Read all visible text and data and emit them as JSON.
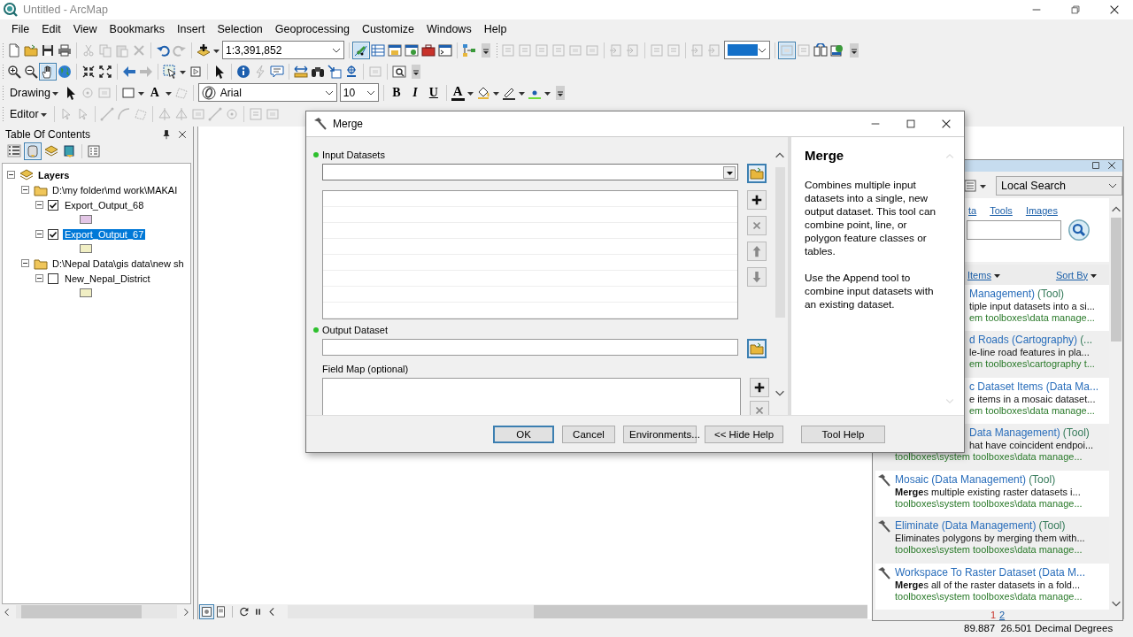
{
  "window": {
    "title": "Untitled - ArcMap"
  },
  "menu": [
    "File",
    "Edit",
    "View",
    "Bookmarks",
    "Insert",
    "Selection",
    "Geoprocessing",
    "Customize",
    "Windows",
    "Help"
  ],
  "toolbars": {
    "scale": "1:3,391,852",
    "drawing_menu": "Drawing",
    "text_tool": "A",
    "font": "Arial",
    "font_size": "10",
    "format_buttons": [
      "B",
      "I",
      "U"
    ],
    "font_color": "A",
    "editor_menu": "Editor"
  },
  "table_of_contents": {
    "title": "Table Of Contents",
    "tree": [
      {
        "kind": "frame",
        "label": "Layers",
        "expanded": true,
        "children": [
          {
            "kind": "group",
            "label": "D:\\my folder\\md work\\MAKAI",
            "expanded": true,
            "children": [
              {
                "kind": "layer",
                "label": "Export_Output_68",
                "expanded": true,
                "checked": true,
                "selected": false,
                "color": "#e3c6e6"
              },
              {
                "kind": "layer",
                "label": "Export_Output_67",
                "expanded": true,
                "checked": true,
                "selected": true,
                "color": "#f1efc4"
              }
            ]
          },
          {
            "kind": "group",
            "label": "D:\\Nepal Data\\gis data\\new sh",
            "expanded": true,
            "children": [
              {
                "kind": "layer",
                "label": "New_Nepal_District",
                "expanded": true,
                "checked": false,
                "selected": false,
                "color": "#f1efc4"
              }
            ]
          }
        ]
      }
    ]
  },
  "merge_dialog": {
    "title": "Merge",
    "parameters": [
      {
        "kind": "multivalue",
        "label": "Input Datasets",
        "required": true
      },
      {
        "kind": "dataset",
        "label": "Output Dataset",
        "required": true
      },
      {
        "kind": "field_map",
        "label": "Field Map (optional)",
        "required": false
      }
    ],
    "help": {
      "title": "Merge",
      "paragraphs": [
        "Combines multiple input datasets into a single, new output dataset. This tool can combine point, line, or polygon feature classes or tables.",
        "Use the Append tool to combine input datasets with an existing dataset."
      ]
    },
    "buttons": [
      {
        "label": "OK",
        "default": true
      },
      {
        "label": "Cancel",
        "default": false
      },
      {
        "label": "Environments...",
        "default": false
      },
      {
        "label": "<< Hide Help",
        "default": false
      },
      {
        "label": "Tool Help",
        "default": false
      }
    ]
  },
  "search_window": {
    "scope": "Local Search",
    "tabs": [
      "ta",
      "Tools",
      "Images"
    ],
    "filter": "Items",
    "sort": "Sort By",
    "results": [
      {
        "kind": "covered",
        "title": "Management)",
        "type": "(Tool)",
        "description": "tiple input datasets into a si...",
        "path": "em toolboxes\\data manage..."
      },
      {
        "kind": "covered",
        "title": "d Roads (Cartography)",
        "type": "(...",
        "description": "le-line road features in pla...",
        "path": "em toolboxes\\cartography t..."
      },
      {
        "kind": "covered",
        "title": "c Dataset Items (Data Ma...",
        "description": "e items in a mosaic dataset...",
        "path": "em toolboxes\\data manage..."
      },
      {
        "kind": "partly_covered",
        "title": "Data Management)",
        "type": "(Tool)",
        "description": "hat have coincident endpoi...",
        "path": "toolboxes\\system toolboxes\\data manage..."
      },
      {
        "kind": "full",
        "title": "Mosaic (Data Management)",
        "type": "(Tool)",
        "description": "**Merge**s multiple existing raster datasets i...",
        "path": "toolboxes\\system toolboxes\\data manage..."
      },
      {
        "kind": "full",
        "title": "Eliminate (Data Management)",
        "type": "(Tool)",
        "description": "Eliminates polygons by merging them with...",
        "path": "toolboxes\\system toolboxes\\data manage..."
      },
      {
        "kind": "full",
        "title": "Workspace To Raster Dataset (Data M...",
        "description": "**Merge**s all of the raster datasets in a fold...",
        "path": "toolboxes\\system toolboxes\\data manage..."
      }
    ],
    "pages": [
      {
        "label": "1",
        "selected": true
      },
      {
        "label": "2",
        "selected": false
      }
    ]
  },
  "status_bar": {
    "coordinates": "89.887  26.501 Decimal Degrees"
  }
}
